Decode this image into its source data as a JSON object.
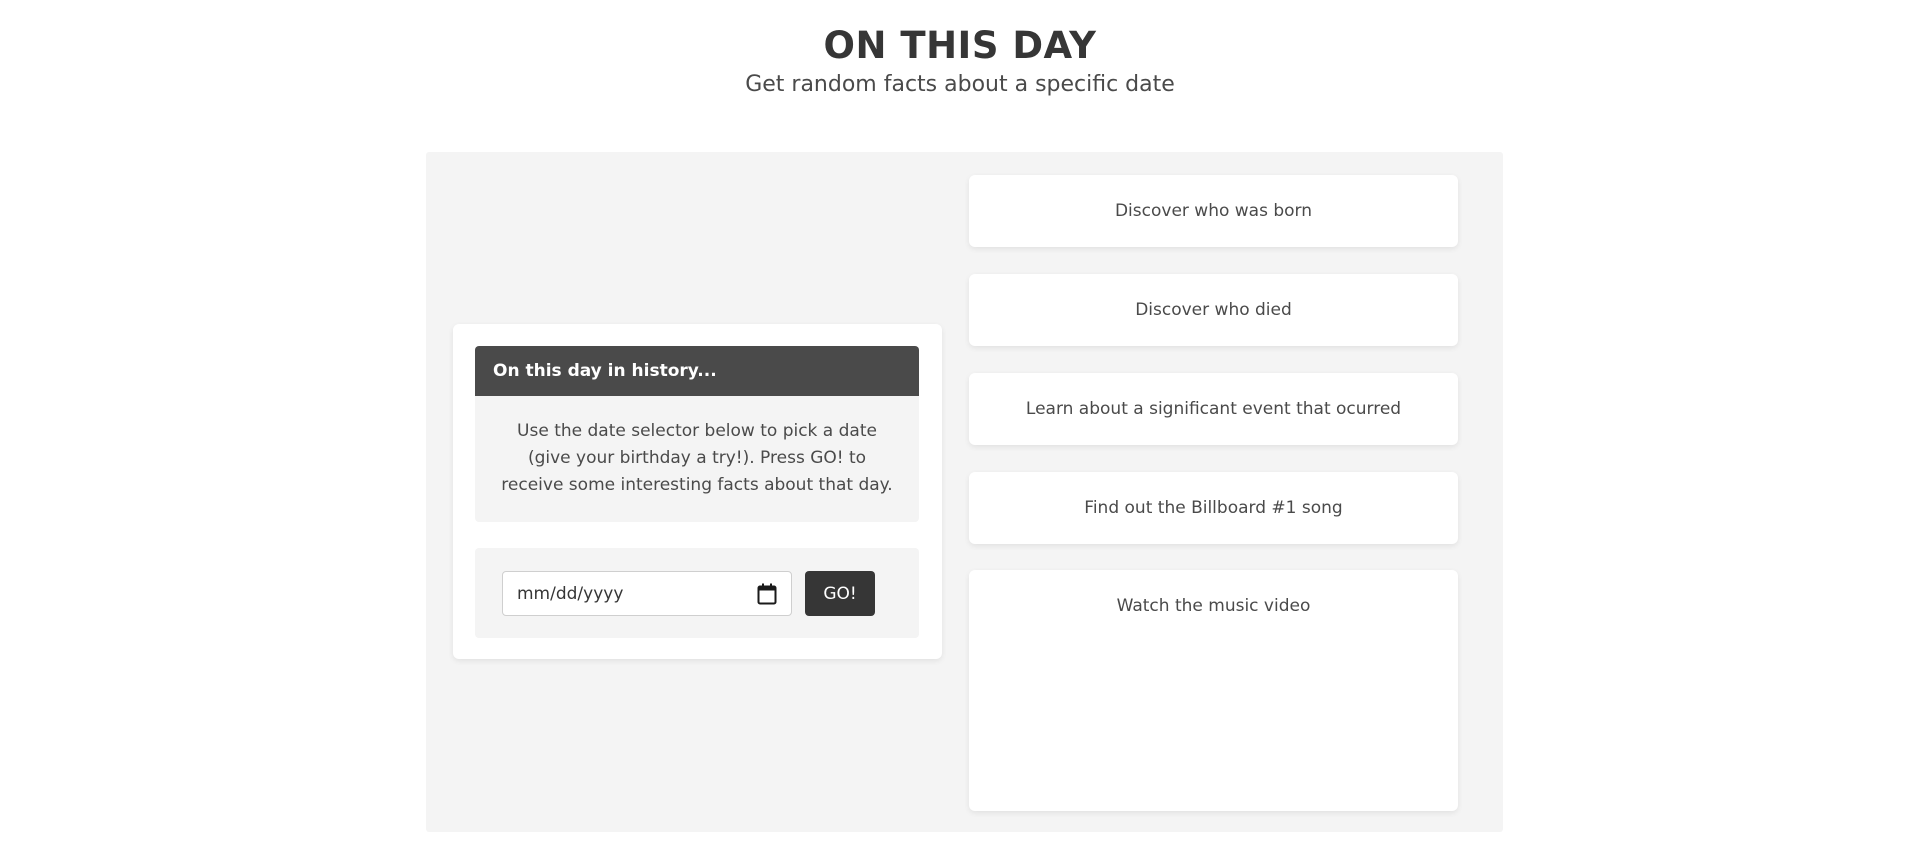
{
  "header": {
    "title": "ON THIS DAY",
    "subtitle": "Get random facts about a specific date"
  },
  "info_card": {
    "heading": "On this day in history...",
    "description": "Use the date selector below to pick a date (give your birthday a try!). Press GO! to receive some interesting facts about that day."
  },
  "date_form": {
    "placeholder": "mm/dd/yyyy",
    "go_label": "GO!"
  },
  "facts": {
    "born": "Discover who was born",
    "died": "Discover who died",
    "event": "Learn about a significant event that ocurred",
    "song": "Find out the Billboard #1 song",
    "video": "Watch the music video"
  },
  "colors": {
    "dark": "#363636",
    "header_bg": "#4a4a4a",
    "panel_bg": "#f4f4f4"
  },
  "icons": {
    "calendar": "calendar-icon"
  }
}
